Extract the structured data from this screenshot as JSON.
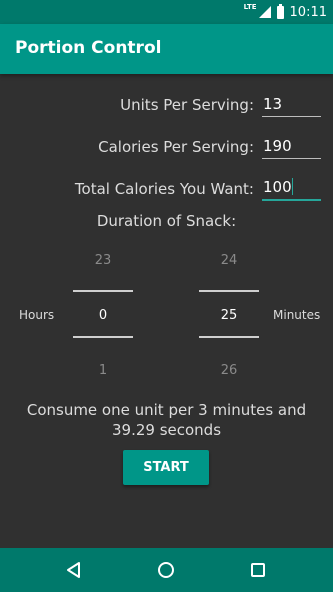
{
  "status": {
    "network": "LTE",
    "time": "10:11"
  },
  "app": {
    "title": "Portion Control"
  },
  "form": {
    "units_label": "Units Per Serving:",
    "units_value": "13",
    "calories_label": "Calories Per Serving:",
    "calories_value": "190",
    "total_label": "Total Calories You Want:",
    "total_value": "100"
  },
  "duration": {
    "title": "Duration of Snack:",
    "hours_label": "Hours",
    "minutes_label": "Minutes",
    "hours": {
      "prev": "23",
      "current": "0",
      "next": "1"
    },
    "minutes": {
      "prev": "24",
      "current": "25",
      "next": "26"
    }
  },
  "result": {
    "line1": "Consume one unit per 3 minutes and",
    "line2": "39.29 seconds"
  },
  "start_button": "START",
  "nav": {
    "icons": [
      "back-icon",
      "home-icon",
      "recents-icon"
    ]
  },
  "colors": {
    "primary": "#009688",
    "primary_dark": "#00796b",
    "background": "#303030",
    "accent": "#26a69a"
  }
}
